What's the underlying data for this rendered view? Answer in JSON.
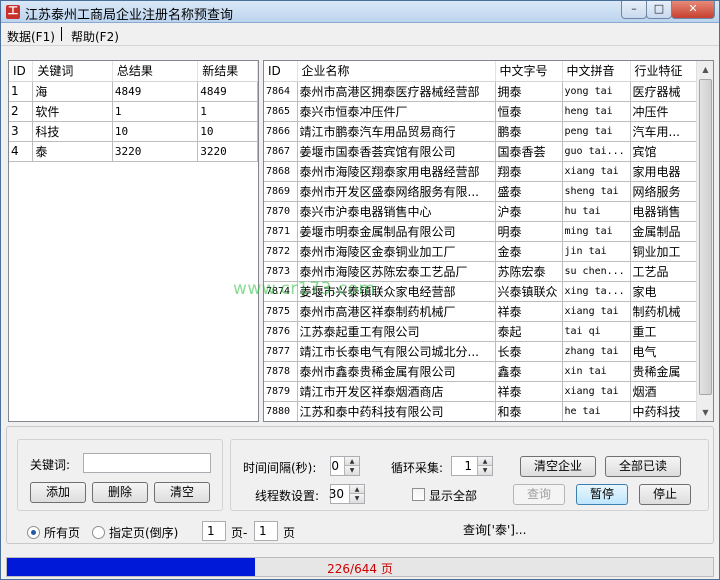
{
  "window": {
    "title": "江苏泰州工商局企业注册名称预查询",
    "controls": {
      "minimize": "–",
      "maximize": "□",
      "close": "✕"
    }
  },
  "menu": {
    "items": [
      "数据(F1)",
      "帮助(F2)"
    ],
    "separator": "|"
  },
  "keywords_table": {
    "headers": [
      "ID",
      "关键词",
      "总结果",
      "新结果"
    ],
    "rows": [
      [
        "1",
        "海",
        "4849",
        "4849"
      ],
      [
        "2",
        "软件",
        "1",
        "1"
      ],
      [
        "3",
        "科技",
        "10",
        "10"
      ],
      [
        "4",
        "泰",
        "3220",
        "3220"
      ]
    ]
  },
  "results_table": {
    "headers": [
      "ID",
      "企业名称",
      "中文字号",
      "中文拼音",
      "行业特征"
    ],
    "rows": [
      [
        "7864",
        "泰州市高港区拥泰医疗器械经营部",
        "拥泰",
        "yong tai",
        "医疗器械"
      ],
      [
        "7865",
        "泰兴市恒泰冲压件厂",
        "恒泰",
        "heng tai",
        "冲压件"
      ],
      [
        "7866",
        "靖江市鹏泰汽车用品贸易商行",
        "鹏泰",
        "peng tai",
        "汽车用..."
      ],
      [
        "7867",
        "姜堰市国泰香荟宾馆有限公司",
        "国泰香荟",
        "guo tai...",
        "宾馆"
      ],
      [
        "7868",
        "泰州市海陵区翔泰家用电器经营部",
        "翔泰",
        "xiang tai",
        "家用电器"
      ],
      [
        "7869",
        "泰州市开发区盛泰网络服务有限...",
        "盛泰",
        "sheng tai",
        "网络服务"
      ],
      [
        "7870",
        "泰兴市沪泰电器销售中心",
        "沪泰",
        "hu tai",
        "电器销售"
      ],
      [
        "7871",
        "姜堰市明泰金属制品有限公司",
        "明泰",
        "ming tai",
        "金属制品"
      ],
      [
        "7872",
        "泰州市海陵区金泰铜业加工厂",
        "金泰",
        "jin tai",
        "铜业加工"
      ],
      [
        "7873",
        "泰州市海陵区苏陈宏泰工艺品厂",
        "苏陈宏泰",
        "su chen...",
        "工艺品"
      ],
      [
        "7874",
        "姜堰市兴泰镇联众家电经营部",
        "兴泰镇联众",
        "xing ta...",
        "家电"
      ],
      [
        "7875",
        "泰州市高港区祥泰制药机械厂",
        "祥泰",
        "xiang tai",
        "制药机械"
      ],
      [
        "7876",
        "江苏泰起重工有限公司",
        "泰起",
        "tai qi",
        "重工"
      ],
      [
        "7877",
        "靖江市长泰电气有限公司城北分...",
        "长泰",
        "zhang tai",
        "电气"
      ],
      [
        "7878",
        "泰州市鑫泰贵稀金属有限公司",
        "鑫泰",
        "xin tai",
        "贵稀金属"
      ],
      [
        "7879",
        "靖江市开发区祥泰烟酒商店",
        "祥泰",
        "xiang tai",
        "烟酒"
      ],
      [
        "7880",
        "江苏和泰中药科技有限公司",
        "和泰",
        "he tai",
        "中药科技"
      ]
    ]
  },
  "watermark": "www.cr173.com",
  "controls": {
    "keyword_label": "关键词:",
    "keyword_value": "",
    "add": "添加",
    "delete": "删除",
    "clear": "清空",
    "interval_label": "时间间隔(秒):",
    "interval_value": "0",
    "threads_label": "线程数设置:",
    "threads_value": "30",
    "loop_label": "循环采集:",
    "loop_value": "1",
    "show_all_label": "显示全部",
    "show_all_checked": false,
    "clear_companies": "清空企业",
    "all_read": "全部已读",
    "query": "查询",
    "pause": "暂停",
    "stop": "停止",
    "all_pages_label": "所有页",
    "specified_pages_label": "指定页(倒序)",
    "page_from": "1",
    "page_sep": "页-",
    "page_to": "1",
    "page_suffix": "页",
    "query_status": "查询['泰']..."
  },
  "status": {
    "text": "226/644 页",
    "progress": 0.351
  },
  "colors": {
    "progress": "#0018d8",
    "status_text": "#cc0000",
    "watermark": "#28be3c"
  }
}
